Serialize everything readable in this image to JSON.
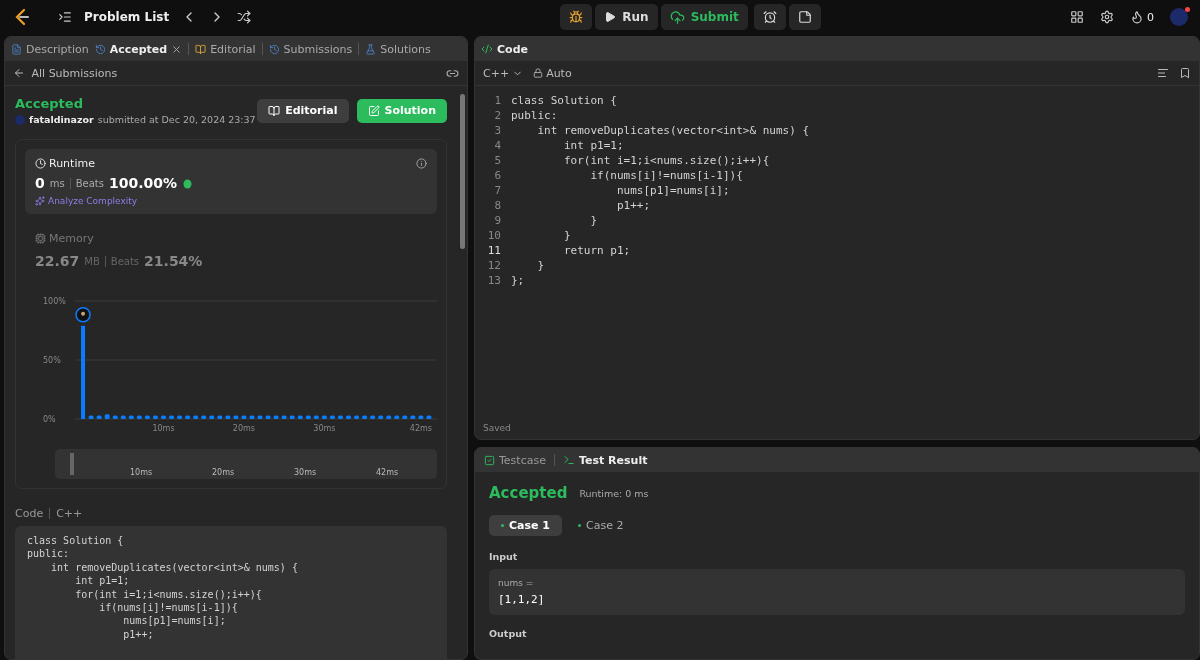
{
  "topbar": {
    "title": "Problem List",
    "run": "Run",
    "submit": "Submit",
    "streak": "0"
  },
  "left_tabs": [
    {
      "label": "Description",
      "selected": false,
      "kind": "doc"
    },
    {
      "label": "Accepted",
      "selected": true,
      "kind": "history"
    },
    {
      "label": "Editorial",
      "selected": false,
      "kind": "book"
    },
    {
      "label": "Submissions",
      "selected": false,
      "kind": "history"
    },
    {
      "label": "Solutions",
      "selected": false,
      "kind": "flask"
    }
  ],
  "back_link": "All Submissions",
  "submission": {
    "status": "Accepted",
    "user": "fataldinazor",
    "submitted": "submitted at Dec 20, 2024 23:37",
    "editorial_button": "Editorial",
    "solution_button": "Solution"
  },
  "runtime": {
    "title": "Runtime",
    "value": "0",
    "unit": "ms",
    "beats_label": "Beats",
    "beats": "100.00%",
    "analyze": "Analyze Complexity"
  },
  "memory": {
    "title": "Memory",
    "value": "22.67",
    "unit": "MB",
    "beats_label": "Beats",
    "beats": "21.54%"
  },
  "chart_data": {
    "type": "bar",
    "x": [
      0,
      1,
      2,
      3,
      4,
      5,
      6,
      7,
      8,
      9,
      10,
      11,
      12,
      13,
      14,
      15,
      16,
      17,
      18,
      19,
      20,
      21,
      22,
      23,
      24,
      25,
      26,
      27,
      28,
      29,
      30,
      31,
      32,
      33,
      34,
      35,
      36,
      37,
      38,
      39,
      40,
      41,
      42,
      43
    ],
    "values": [
      79,
      3,
      3,
      4,
      3,
      3,
      3,
      3,
      3,
      3,
      3,
      3,
      3,
      3,
      3,
      3,
      3,
      3,
      3,
      3,
      3,
      3,
      3,
      3,
      3,
      3,
      3,
      3,
      3,
      3,
      3,
      3,
      3,
      3,
      3,
      3,
      3,
      3,
      3,
      3,
      3,
      3,
      3,
      3
    ],
    "xlim": [
      -1,
      44
    ],
    "ylim": [
      0,
      100
    ],
    "yticks": [
      {
        "value": 0,
        "label": "0%"
      },
      {
        "value": 50,
        "label": "50%"
      },
      {
        "value": 100,
        "label": "100%"
      }
    ],
    "xticks": [
      {
        "value": 10,
        "label": "10ms"
      },
      {
        "value": 20,
        "label": "20ms"
      },
      {
        "value": 30,
        "label": "30ms"
      },
      {
        "value": 42,
        "label": "42ms"
      }
    ]
  },
  "navigator_labels": [
    "10ms",
    "20ms",
    "30ms",
    "42ms"
  ],
  "left_code": {
    "label": "Code",
    "language": "C++",
    "lines": [
      "class Solution {",
      "public:",
      "    int removeDuplicates(vector<int>& nums) {",
      "        int p1=1;",
      "        for(int i=1;i<nums.size();i++){",
      "            if(nums[i]!=nums[i-1]){",
      "                nums[p1]=nums[i];",
      "                p1++;"
    ]
  },
  "editor": {
    "title": "Code",
    "language": "C++",
    "mode": "Auto",
    "status": "Saved",
    "lines": [
      {
        "number": "1",
        "text": "class Solution {",
        "current": false
      },
      {
        "number": "2",
        "text": "public:",
        "current": false
      },
      {
        "number": "3",
        "text": "    int removeDuplicates(vector<int>& nums) {",
        "current": false
      },
      {
        "number": "4",
        "text": "        int p1=1;",
        "current": false
      },
      {
        "number": "5",
        "text": "        for(int i=1;i<nums.size();i++){",
        "current": false
      },
      {
        "number": "6",
        "text": "            if(nums[i]!=nums[i-1]){",
        "current": false
      },
      {
        "number": "7",
        "text": "                nums[p1]=nums[i];",
        "current": false
      },
      {
        "number": "8",
        "text": "                p1++;",
        "current": false
      },
      {
        "number": "9",
        "text": "            }",
        "current": false
      },
      {
        "number": "10",
        "text": "        }",
        "current": false
      },
      {
        "number": "11",
        "text": "        return p1;",
        "current": true
      },
      {
        "number": "12",
        "text": "    }",
        "current": false
      },
      {
        "number": "13",
        "text": "};",
        "current": false
      }
    ]
  },
  "bottom_tabs": [
    {
      "label": "Testcase",
      "selected": false,
      "kind": "check"
    },
    {
      "label": "Test Result",
      "selected": true,
      "kind": "terminal"
    }
  ],
  "result": {
    "status": "Accepted",
    "runtime": "Runtime: 0 ms",
    "cases": [
      {
        "label": "Case 1",
        "selected": true
      },
      {
        "label": "Case 2",
        "selected": false
      }
    ],
    "input_label": "Input",
    "var_name": "nums =",
    "var_value": "[1,1,2]",
    "output_label": "Output"
  }
}
